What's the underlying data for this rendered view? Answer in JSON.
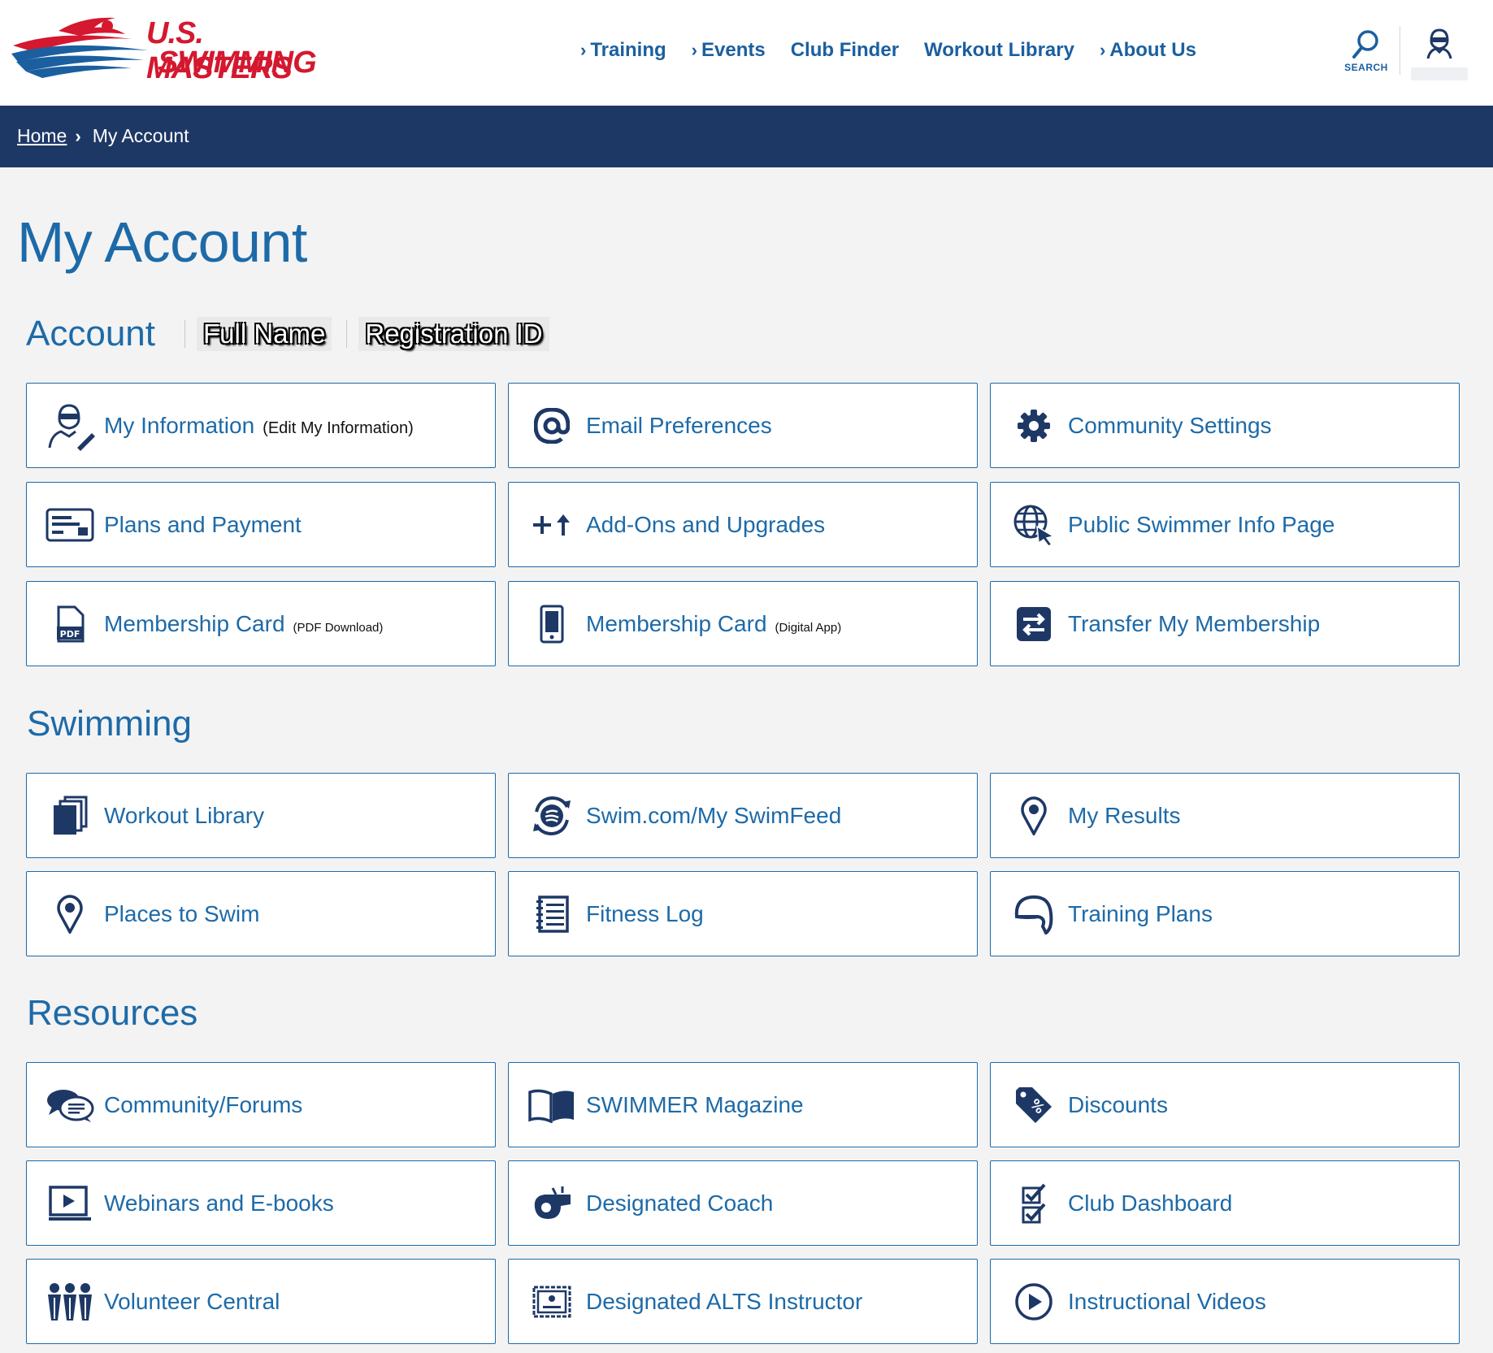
{
  "brand": {
    "line1": "U.S. MASTERS",
    "line2": "SWIMMING",
    "red": "#d4182f",
    "blue": "#1b5f9f"
  },
  "nav": [
    {
      "label": "Training",
      "chevron": true
    },
    {
      "label": "Events",
      "chevron": true
    },
    {
      "label": "Club Finder",
      "chevron": false
    },
    {
      "label": "Workout Library",
      "chevron": false
    },
    {
      "label": "About Us",
      "chevron": true
    }
  ],
  "search": {
    "label": "SEARCH"
  },
  "breadcrumb": {
    "home": "Home",
    "current": "My Account"
  },
  "page_title": "My Account",
  "account": {
    "heading": "Account",
    "full_name": "Full Name",
    "registration_id": "Registration ID"
  },
  "sections": {
    "swimming": "Swimming",
    "resources": "Resources"
  },
  "cards": {
    "my_information": {
      "label": "My Information",
      "sub": "(Edit My Information)",
      "icon": "swimmer-edit-icon"
    },
    "email_preferences": {
      "label": "Email Preferences",
      "icon": "at-sign-icon"
    },
    "community_settings": {
      "label": "Community Settings",
      "icon": "gear-icon"
    },
    "plans_payment": {
      "label": "Plans and Payment",
      "icon": "credit-card-icon"
    },
    "addons": {
      "label": "Add-Ons and Upgrades",
      "icon": "plus-up-arrow-icon"
    },
    "public_info": {
      "label": "Public Swimmer Info Page",
      "icon": "globe-cursor-icon"
    },
    "card_pdf": {
      "label": "Membership Card",
      "sub": "(PDF Download)",
      "icon": "pdf-file-icon"
    },
    "card_app": {
      "label": "Membership Card",
      "sub": "(Digital App)",
      "icon": "mobile-phone-icon"
    },
    "transfer": {
      "label": "Transfer My Membership",
      "icon": "transfer-arrows-icon"
    },
    "workout_library": {
      "label": "Workout Library",
      "icon": "stacked-pages-icon"
    },
    "swimfeed": {
      "label": "Swim.com/My SwimFeed",
      "icon": "sync-icon"
    },
    "my_results": {
      "label": "My Results",
      "icon": "location-pin-icon"
    },
    "places_to_swim": {
      "label": "Places to Swim",
      "icon": "map-pin-icon"
    },
    "fitness_log": {
      "label": "Fitness Log",
      "icon": "notebook-icon"
    },
    "training_plans": {
      "label": "Training Plans",
      "icon": "swim-cap-icon"
    },
    "forums": {
      "label": "Community/Forums",
      "icon": "chat-bubbles-icon"
    },
    "magazine": {
      "label": "SWIMMER Magazine",
      "icon": "open-book-icon"
    },
    "discounts": {
      "label": "Discounts",
      "icon": "percent-tag-icon"
    },
    "webinars": {
      "label": "Webinars and E-books",
      "icon": "video-screen-icon"
    },
    "coach": {
      "label": "Designated Coach",
      "icon": "whistle-icon"
    },
    "club_dashboard": {
      "label": "Club Dashboard",
      "icon": "checklist-icon"
    },
    "volunteer": {
      "label": "Volunteer Central",
      "icon": "people-group-icon"
    },
    "alts": {
      "label": "Designated ALTS Instructor",
      "icon": "certificate-icon"
    },
    "videos": {
      "label": "Instructional Videos",
      "icon": "play-circle-icon"
    }
  },
  "colors": {
    "link": "#1d6aa8",
    "navy": "#1e3866",
    "icon": "#1e3866",
    "page_bg": "#f3f3f3"
  }
}
